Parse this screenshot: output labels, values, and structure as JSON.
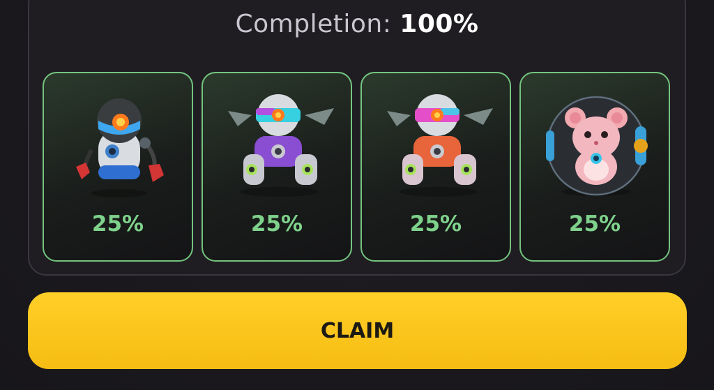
{
  "completion": {
    "label": "Completion:",
    "value": "100%"
  },
  "cards": [
    {
      "name": "boxing-robot",
      "percent": "25%",
      "icon": "boxing-robot-icon"
    },
    {
      "name": "purple-mech",
      "percent": "25%",
      "icon": "purple-mech-icon"
    },
    {
      "name": "orange-mech",
      "percent": "25%",
      "icon": "orange-mech-icon"
    },
    {
      "name": "hamster-ball",
      "percent": "25%",
      "icon": "hamster-ball-icon"
    }
  ],
  "claim_button": {
    "label": "CLAIM"
  },
  "colors": {
    "accent_green": "#7fd28c",
    "claim_yellow": "#f9c41a"
  }
}
